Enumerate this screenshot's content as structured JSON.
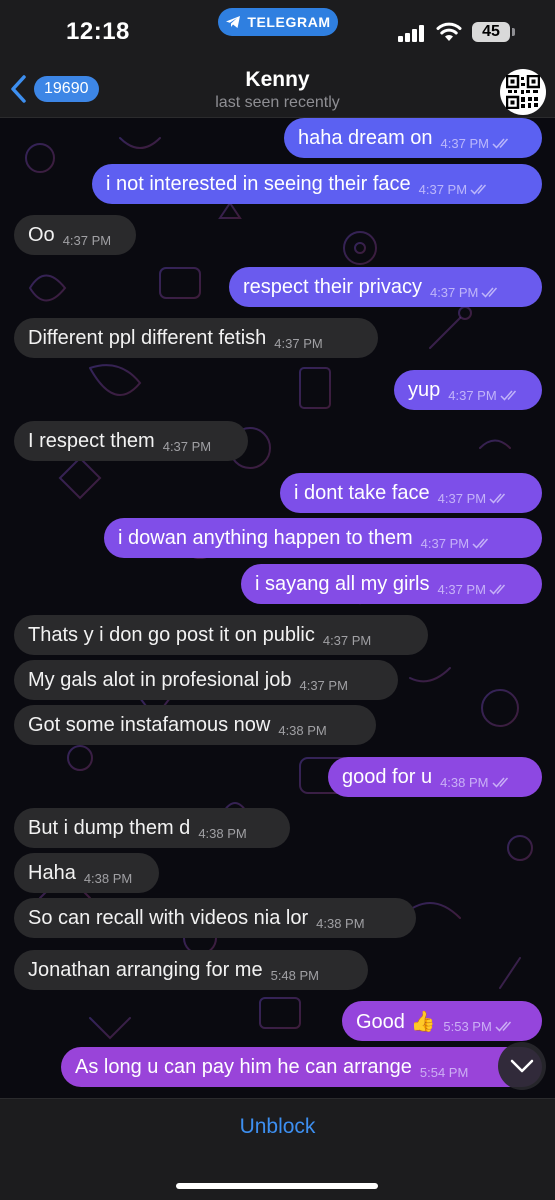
{
  "status_bar": {
    "time": "12:18",
    "app_pill": "TELEGRAM",
    "battery": "45",
    "icons": [
      "signal-icon",
      "wifi-icon",
      "battery-icon"
    ]
  },
  "header": {
    "back_count": "19690",
    "title": "Kenny",
    "subtitle": "last seen recently",
    "avatar_icon": "qr-code-icon"
  },
  "colors": {
    "incoming_bubble": "#2a2a2c",
    "outgoing_top": "#5d63f2",
    "outgoing_bottom": "#9a45d8",
    "link_blue": "#3d8ff0"
  },
  "messages": [
    {
      "dir": "out",
      "text": "haha dream on",
      "time": "4:37 PM"
    },
    {
      "dir": "out",
      "text": "i not interested in seeing their face",
      "time": "4:37 PM"
    },
    {
      "dir": "in",
      "text": "Oo",
      "time": "4:37 PM"
    },
    {
      "dir": "out",
      "text": "respect their privacy",
      "time": "4:37 PM"
    },
    {
      "dir": "in",
      "text": "Different ppl different fetish",
      "time": "4:37 PM"
    },
    {
      "dir": "out",
      "text": "yup",
      "time": "4:37 PM"
    },
    {
      "dir": "in",
      "text": "I respect them",
      "time": "4:37 PM"
    },
    {
      "dir": "out",
      "text": "i dont take face",
      "time": "4:37 PM"
    },
    {
      "dir": "out",
      "text": "i dowan anything happen to them",
      "time": "4:37 PM"
    },
    {
      "dir": "out",
      "text": "i sayang all my girls",
      "time": "4:37 PM"
    },
    {
      "dir": "in",
      "text": "Thats y i don go post it on public",
      "time": "4:37 PM"
    },
    {
      "dir": "in",
      "text": "My gals alot in profesional job",
      "time": "4:37 PM"
    },
    {
      "dir": "in",
      "text": "Got some instafamous now",
      "time": "4:38 PM"
    },
    {
      "dir": "out",
      "text": "good for u",
      "time": "4:38 PM"
    },
    {
      "dir": "in",
      "text": "But i dump them d",
      "time": "4:38 PM"
    },
    {
      "dir": "in",
      "text": "Haha",
      "time": "4:38 PM"
    },
    {
      "dir": "in",
      "text": "So can recall with videos nia lor",
      "time": "4:38 PM"
    },
    {
      "dir": "in",
      "text": "Jonathan arranging for me",
      "time": "5:48 PM"
    },
    {
      "dir": "out",
      "text": "Good 👍",
      "time": "5:53 PM"
    },
    {
      "dir": "out",
      "text": "As long u can pay him he can arrange",
      "time": "5:54 PM"
    }
  ],
  "footer": {
    "action_label": "Unblock",
    "scroll_icon": "chevron-down-icon"
  }
}
